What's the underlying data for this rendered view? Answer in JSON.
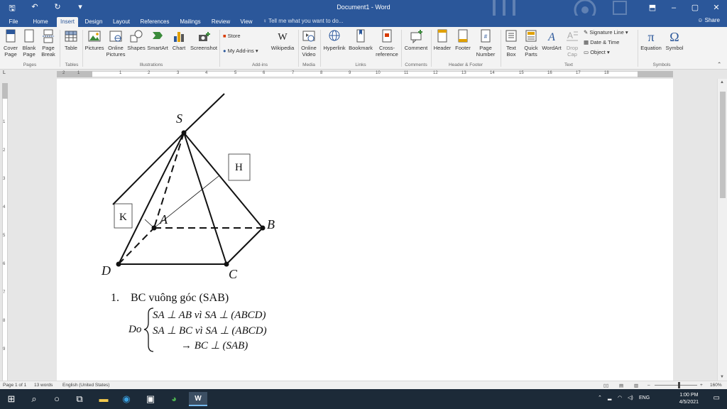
{
  "window": {
    "title": "Document1 - Word",
    "qat_icons": [
      "save-icon",
      "undo-icon",
      "redo-icon",
      "customize-qat-icon"
    ],
    "minimize": "–",
    "restore": "▢",
    "close": "✕",
    "ribbon_display": "⬒"
  },
  "tabs": {
    "items": [
      "File",
      "Home",
      "Insert",
      "Design",
      "Layout",
      "References",
      "Mailings",
      "Review",
      "View"
    ],
    "active": "Insert",
    "tell_me": "Tell me what you want to do...",
    "share": "Share"
  },
  "ribbon": {
    "pages": {
      "cover": "Cover Page",
      "blank": "Blank Page",
      "break": "Page Break",
      "group": "Pages"
    },
    "tables": {
      "table": "Table",
      "group": "Tables"
    },
    "illustrations": {
      "pictures": "Pictures",
      "online_pictures": "Online Pictures",
      "shapes": "Shapes",
      "smartart": "SmartArt",
      "chart": "Chart",
      "screenshot": "Screenshot",
      "group": "Illustrations"
    },
    "addins": {
      "store": "Store",
      "my_addins": "My Add-ins",
      "wikipedia": "Wikipedia",
      "group": "Add-ins"
    },
    "media": {
      "online_video": "Online Video",
      "group": "Media"
    },
    "links": {
      "hyperlink": "Hyperlink",
      "bookmark": "Bookmark",
      "cross_reference": "Cross-reference",
      "group": "Links"
    },
    "comments": {
      "comment": "Comment",
      "group": "Comments"
    },
    "header_footer": {
      "header": "Header",
      "footer": "Footer",
      "page_number": "Page Number",
      "group": "Header & Footer"
    },
    "text": {
      "text_box": "Text Box",
      "quick_parts": "Quick Parts",
      "wordart": "WordArt",
      "drop_cap": "Drop Cap",
      "signature_line": "Signature Line",
      "date_time": "Date & Time",
      "object": "Object",
      "group": "Text"
    },
    "symbols": {
      "equation": "Equation",
      "symbol": "Symbol",
      "group": "Symbols"
    }
  },
  "ruler": {
    "numbers": [
      "2",
      "1",
      "1",
      "2",
      "3",
      "4",
      "5",
      "6",
      "7",
      "8",
      "9",
      "10",
      "11",
      "12",
      "13",
      "14",
      "15",
      "16",
      "17",
      "18"
    ],
    "vertical_numbers": [
      "1",
      "2",
      "3",
      "4",
      "5",
      "6",
      "7",
      "8",
      "9"
    ]
  },
  "document": {
    "figure": {
      "labels": {
        "S": "S",
        "A": "A",
        "B": "B",
        "C": "C",
        "D": "D"
      },
      "callouts": {
        "H": "H",
        "K": "K"
      }
    },
    "list_number": "1.",
    "list_text": "BC vuông góc (SAB)",
    "do_label": "Do",
    "line1": "SA ⊥ AB vì SA ⊥ (ABCD)",
    "line2": "SA ⊥ BC vì SA ⊥ (ABCD)",
    "line3": "→ BC ⊥ (SAB)"
  },
  "status": {
    "page": "Page 1 of 1",
    "words": "13 words",
    "language": "English (United States)",
    "zoom": "160%"
  },
  "taskbar": {
    "language": "ENG",
    "time": "1:00 PM",
    "date": "4/5/2021"
  },
  "colors": {
    "word_blue": "#2b579a",
    "taskbar": "#1c2a38"
  }
}
